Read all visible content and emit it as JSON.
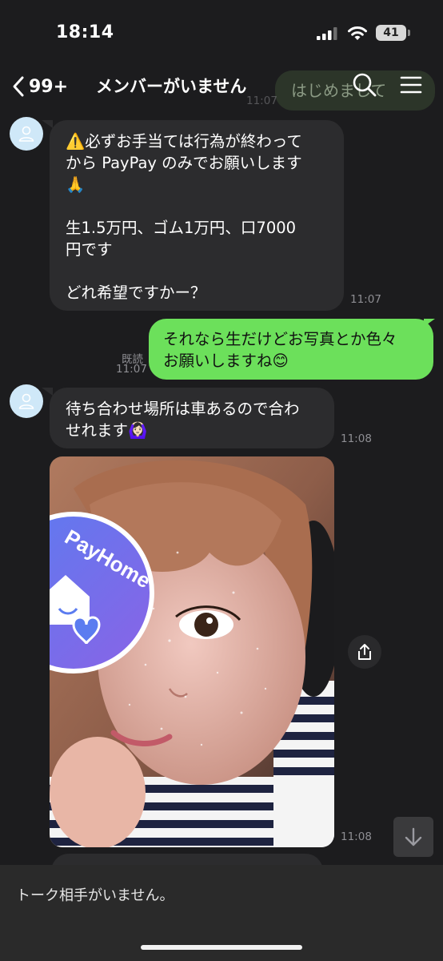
{
  "status_bar": {
    "time": "18:14",
    "battery": "41"
  },
  "header": {
    "unread_count": "99+",
    "title": "メンバーがいません",
    "behind_message_text": "はじめまして",
    "behind_message_time": "11:07"
  },
  "messages": [
    {
      "side": "incoming",
      "text": "⚠️必ずお手当ては行為が終わって\nから PayPay のみでお願いします\n🙏\n\n生1.5万円、ゴム1万円、口7000\n円です\n\nどれ希望ですかー？",
      "time": "11:07"
    },
    {
      "side": "outgoing",
      "text": "それなら生だけどお写真とか色々\nお願いしますね😊",
      "read_label": "既読",
      "time": "11:07"
    },
    {
      "side": "incoming",
      "text": "待ち合わせ場所は車あるので合わ\nせれます🙆🏻‍♀️",
      "time": "11:08"
    },
    {
      "side": "incoming",
      "type": "photo",
      "sticker_text": "PayHome",
      "time": "11:08"
    }
  ],
  "footer": {
    "status_text": "トーク相手がいません。"
  },
  "icons": {
    "back": "chevron-left-icon",
    "search": "search-icon",
    "menu": "hamburger-menu-icon",
    "share": "share-icon",
    "scroll_down": "arrow-down-icon",
    "avatar": "person-icon"
  },
  "colors": {
    "background": "#1c1c1e",
    "incoming_bubble": "#2c2c2e",
    "outgoing_bubble": "#6ce05b",
    "timestamp": "#8e8e93"
  }
}
